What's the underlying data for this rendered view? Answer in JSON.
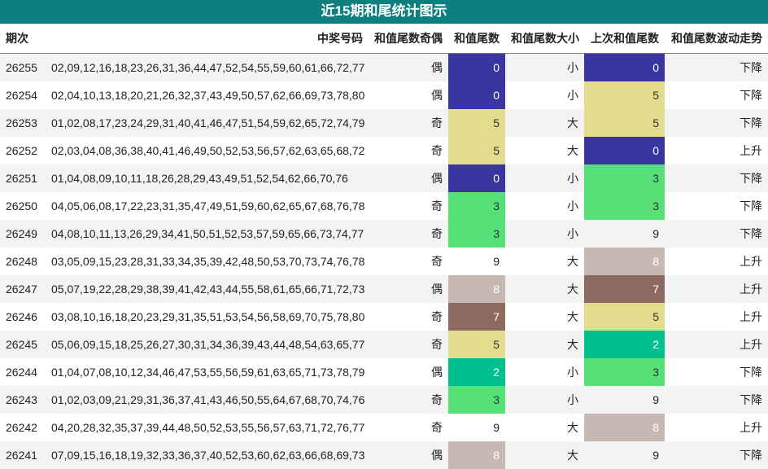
{
  "title": "近15期和尾统计图示",
  "columns": [
    "期次",
    "中奖号码",
    "和值尾数奇偶",
    "和值尾数",
    "和值尾数大小",
    "上次和值尾数",
    "和值尾数波动走势"
  ],
  "colors": {
    "0": "#3a36a0",
    "2": "#00c090",
    "3": "#55e078",
    "5": "#e3dc8e",
    "7": "#8c6a60",
    "8": "#c7b8b4",
    "9": "#ffffff"
  },
  "rows": [
    {
      "issue": "26255",
      "numbers": "02,09,12,16,18,23,26,31,36,44,47,52,54,55,59,60,61,66,72,77",
      "parity": "偶",
      "tail": "0",
      "size": "小",
      "prev": "0",
      "trend": "下降"
    },
    {
      "issue": "26254",
      "numbers": "02,04,10,13,18,20,21,26,32,37,43,49,50,57,62,66,69,73,78,80",
      "parity": "偶",
      "tail": "0",
      "size": "小",
      "prev": "5",
      "trend": "下降"
    },
    {
      "issue": "26253",
      "numbers": "01,02,08,17,23,24,29,31,40,41,46,47,51,54,59,62,65,72,74,79",
      "parity": "奇",
      "tail": "5",
      "size": "大",
      "prev": "5",
      "trend": "下降"
    },
    {
      "issue": "26252",
      "numbers": "02,03,04,08,36,38,40,41,46,49,50,52,53,56,57,62,63,65,68,72",
      "parity": "奇",
      "tail": "5",
      "size": "大",
      "prev": "0",
      "trend": "上升"
    },
    {
      "issue": "26251",
      "numbers": "01,04,08,09,10,11,18,26,28,29,43,49,51,52,54,62,66,70,76",
      "parity": "偶",
      "tail": "0",
      "size": "小",
      "prev": "3",
      "trend": "下降"
    },
    {
      "issue": "26250",
      "numbers": "04,05,06,08,17,22,23,31,35,47,49,51,59,60,62,65,67,68,76,78",
      "parity": "奇",
      "tail": "3",
      "size": "小",
      "prev": "3",
      "trend": "下降"
    },
    {
      "issue": "26249",
      "numbers": "04,08,10,11,13,26,29,34,41,50,51,52,53,57,59,65,66,73,74,77",
      "parity": "奇",
      "tail": "3",
      "size": "小",
      "prev": "9",
      "trend": "下降"
    },
    {
      "issue": "26248",
      "numbers": "03,05,09,15,23,28,31,33,34,35,39,42,48,50,53,70,73,74,76,78",
      "parity": "奇",
      "tail": "9",
      "size": "大",
      "prev": "8",
      "trend": "上升"
    },
    {
      "issue": "26247",
      "numbers": "05,07,19,22,28,29,38,39,41,42,43,44,55,58,61,65,66,71,72,73",
      "parity": "偶",
      "tail": "8",
      "size": "大",
      "prev": "7",
      "trend": "上升"
    },
    {
      "issue": "26246",
      "numbers": "03,08,10,16,18,20,23,29,31,35,51,53,54,56,58,69,70,75,78,80",
      "parity": "奇",
      "tail": "7",
      "size": "大",
      "prev": "5",
      "trend": "上升"
    },
    {
      "issue": "26245",
      "numbers": "05,06,09,15,18,25,26,27,30,31,34,36,39,43,44,48,54,63,65,77",
      "parity": "奇",
      "tail": "5",
      "size": "大",
      "prev": "2",
      "trend": "上升"
    },
    {
      "issue": "26244",
      "numbers": "01,04,07,08,10,12,34,46,47,53,55,56,59,61,63,65,71,73,78,79",
      "parity": "偶",
      "tail": "2",
      "size": "小",
      "prev": "3",
      "trend": "下降"
    },
    {
      "issue": "26243",
      "numbers": "01,02,03,09,21,29,31,36,37,41,43,46,50,55,64,67,68,70,74,76",
      "parity": "奇",
      "tail": "3",
      "size": "小",
      "prev": "9",
      "trend": "下降"
    },
    {
      "issue": "26242",
      "numbers": "04,20,28,32,35,37,39,44,48,50,52,53,55,56,57,63,71,72,76,77",
      "parity": "奇",
      "tail": "9",
      "size": "大",
      "prev": "8",
      "trend": "上升"
    },
    {
      "issue": "26241",
      "numbers": "07,09,15,16,18,19,32,33,36,37,40,52,53,60,62,63,66,68,69,73",
      "parity": "偶",
      "tail": "8",
      "size": "大",
      "prev": "9",
      "trend": "下降"
    }
  ]
}
